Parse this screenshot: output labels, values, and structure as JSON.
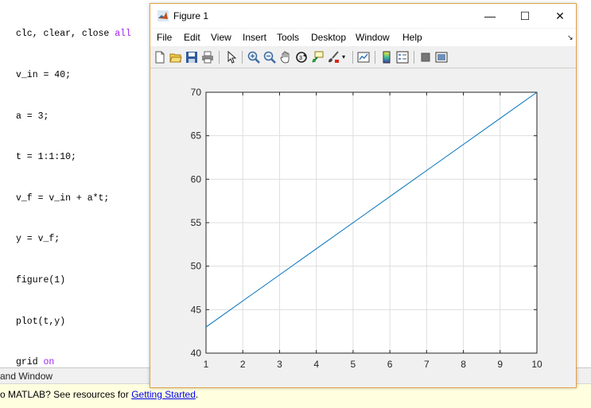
{
  "editor": {
    "lines": [
      {
        "text": "clc, clear, close ",
        "kw": "all"
      },
      {
        "text": "v_in = 40;",
        "kw": ""
      },
      {
        "text": "a = 3;",
        "kw": ""
      },
      {
        "text": "t = 1:1:10;",
        "kw": ""
      },
      {
        "text": "v_f = v_in + a*t;",
        "kw": ""
      },
      {
        "text": "y = v_f;",
        "kw": ""
      },
      {
        "text": "figure(1)",
        "kw": ""
      },
      {
        "text": "plot(t,y)",
        "kw": ""
      },
      {
        "text": "grid ",
        "kw": "on"
      }
    ]
  },
  "command_window": {
    "title": "and Window",
    "message_prefix": "o MATLAB? See resources for ",
    "message_link": "Getting Started",
    "message_suffix": "."
  },
  "figure": {
    "title": "Figure 1",
    "menu": [
      "File",
      "Edit",
      "View",
      "Insert",
      "Tools",
      "Desktop",
      "Window",
      "Help"
    ],
    "menu_arrow": "↘",
    "window_buttons": {
      "minimize": "—",
      "maximize": "☐",
      "close": "✕"
    },
    "toolbar_icons": [
      "new-figure-icon",
      "open-file-icon",
      "save-icon",
      "print-icon",
      "pointer-icon",
      "zoom-in-icon",
      "zoom-out-icon",
      "pan-icon",
      "rotate-3d-icon",
      "data-cursor-icon",
      "brush-icon",
      "link-plot-icon",
      "colorbar-icon",
      "legend-icon",
      "hide-plot-tools-icon",
      "show-plot-tools-icon"
    ]
  },
  "chart_data": {
    "type": "line",
    "x": [
      1,
      2,
      3,
      4,
      5,
      6,
      7,
      8,
      9,
      10
    ],
    "series": [
      {
        "values": [
          43,
          46,
          49,
          52,
          55,
          58,
          61,
          64,
          67,
          70
        ],
        "color": "#0072bd"
      }
    ],
    "xticks": [
      "1",
      "2",
      "3",
      "4",
      "5",
      "6",
      "7",
      "8",
      "9",
      "10"
    ],
    "yticks": [
      "40",
      "45",
      "50",
      "55",
      "60",
      "65",
      "70"
    ],
    "xlim": [
      1,
      10
    ],
    "ylim": [
      40,
      70
    ],
    "grid": true,
    "title": "",
    "xlabel": "",
    "ylabel": ""
  }
}
